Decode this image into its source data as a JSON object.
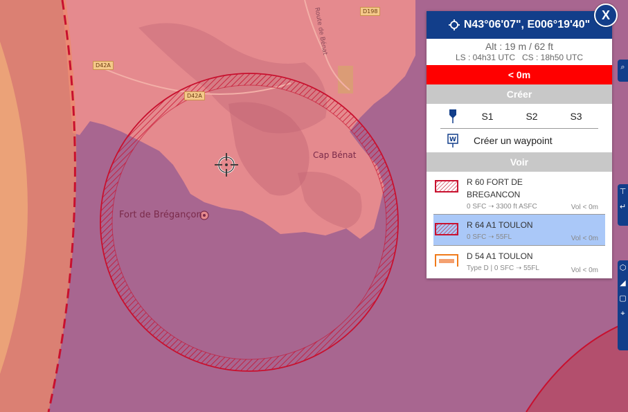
{
  "map": {
    "labels": {
      "fort": "Fort de Brégançon",
      "cap": "Cap Bénat",
      "route": "Route de Bénat"
    },
    "roads": [
      "D198",
      "D42A",
      "D42A"
    ],
    "colors": {
      "sea": "#a86690",
      "land": "#e58a8e",
      "zone_outline": "#c8102e",
      "buffer_orange": "#f0a060"
    }
  },
  "panel": {
    "coords": "N43°06'07\", E006°19'40\"",
    "alt": "Alt : 19 m / 62 ft",
    "times": "LS : 04h31 UTC   CS : 18h50 UTC",
    "alert": "< 0m",
    "create_title": "Créer",
    "slots": [
      "S1",
      "S2",
      "S3"
    ],
    "waypoint_label": "Créer un waypoint",
    "see_title": "Voir",
    "zones": [
      {
        "name": "R 60 FORT DE BREGANCON",
        "sub": "0 SFC ➝ 3300 ft ASFC",
        "vol": "Vol < 0m",
        "selected": false
      },
      {
        "name": "R 64 A1 TOULON",
        "sub": "0 SFC ➝ 55FL",
        "vol": "Vol < 0m",
        "selected": true
      },
      {
        "name": "D 54 A1 TOULON",
        "sub": "Type D | 0 SFC ➝ 55FL",
        "vol": "Vol < 0m",
        "selected": false
      }
    ],
    "close_label": "X"
  },
  "icons": [
    "crosshair-icon",
    "pin-icon",
    "waypoint-icon",
    "search-icon",
    "close-icon"
  ]
}
